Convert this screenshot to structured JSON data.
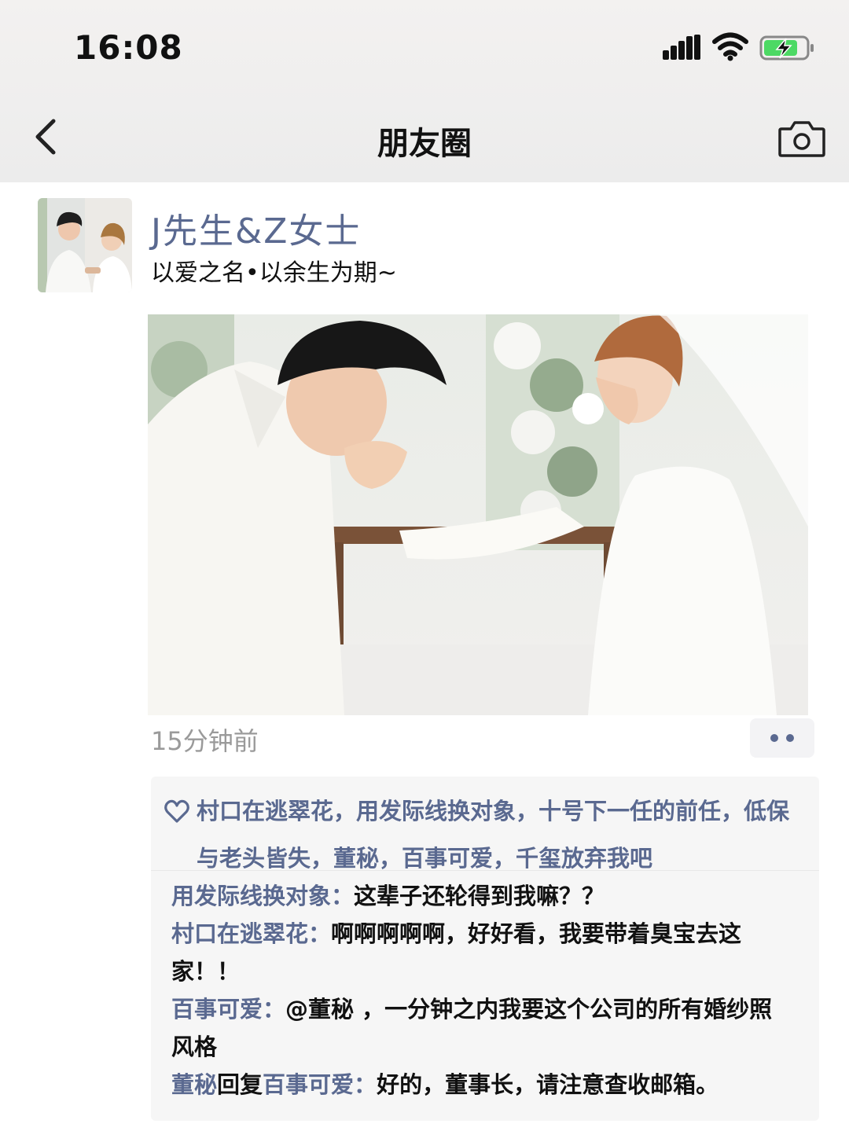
{
  "status_bar": {
    "time": "16:08"
  },
  "nav": {
    "title": "朋友圈",
    "back_icon": "back-chevron",
    "camera_icon": "camera"
  },
  "post": {
    "user_name": "J先生&Z女士",
    "text": "以爱之名•以余生为期~",
    "time": "15分钟前"
  },
  "likes": {
    "names": "村口在逃翠花，用发际线换对象，十号下一任的前任，低保与老头皆失，董秘，百事可爱，千玺放弃我吧"
  },
  "comments": [
    {
      "author": "用发际线换对象",
      "separator": "：",
      "text": "这辈子还轮得到我嘛？？"
    },
    {
      "author": "村口在逃翠花",
      "separator": "：",
      "text": "啊啊啊啊啊，好好看，我要带着臭宝去这家！！"
    },
    {
      "author": "百事可爱",
      "separator": "：",
      "text": "@董秘 ，一分钟之内我要这个公司的所有婚纱照风格"
    },
    {
      "author": "董秘",
      "reply_word": "回复",
      "reply_to": "百事可爱",
      "separator": "：",
      "text": "好的，董事长，请注意查收邮箱。"
    }
  ],
  "colors": {
    "name_blue": "#5a6990",
    "time_gray": "#9a9a9a",
    "comment_bg": "#f6f6f6",
    "header_bg": "#ececec"
  }
}
